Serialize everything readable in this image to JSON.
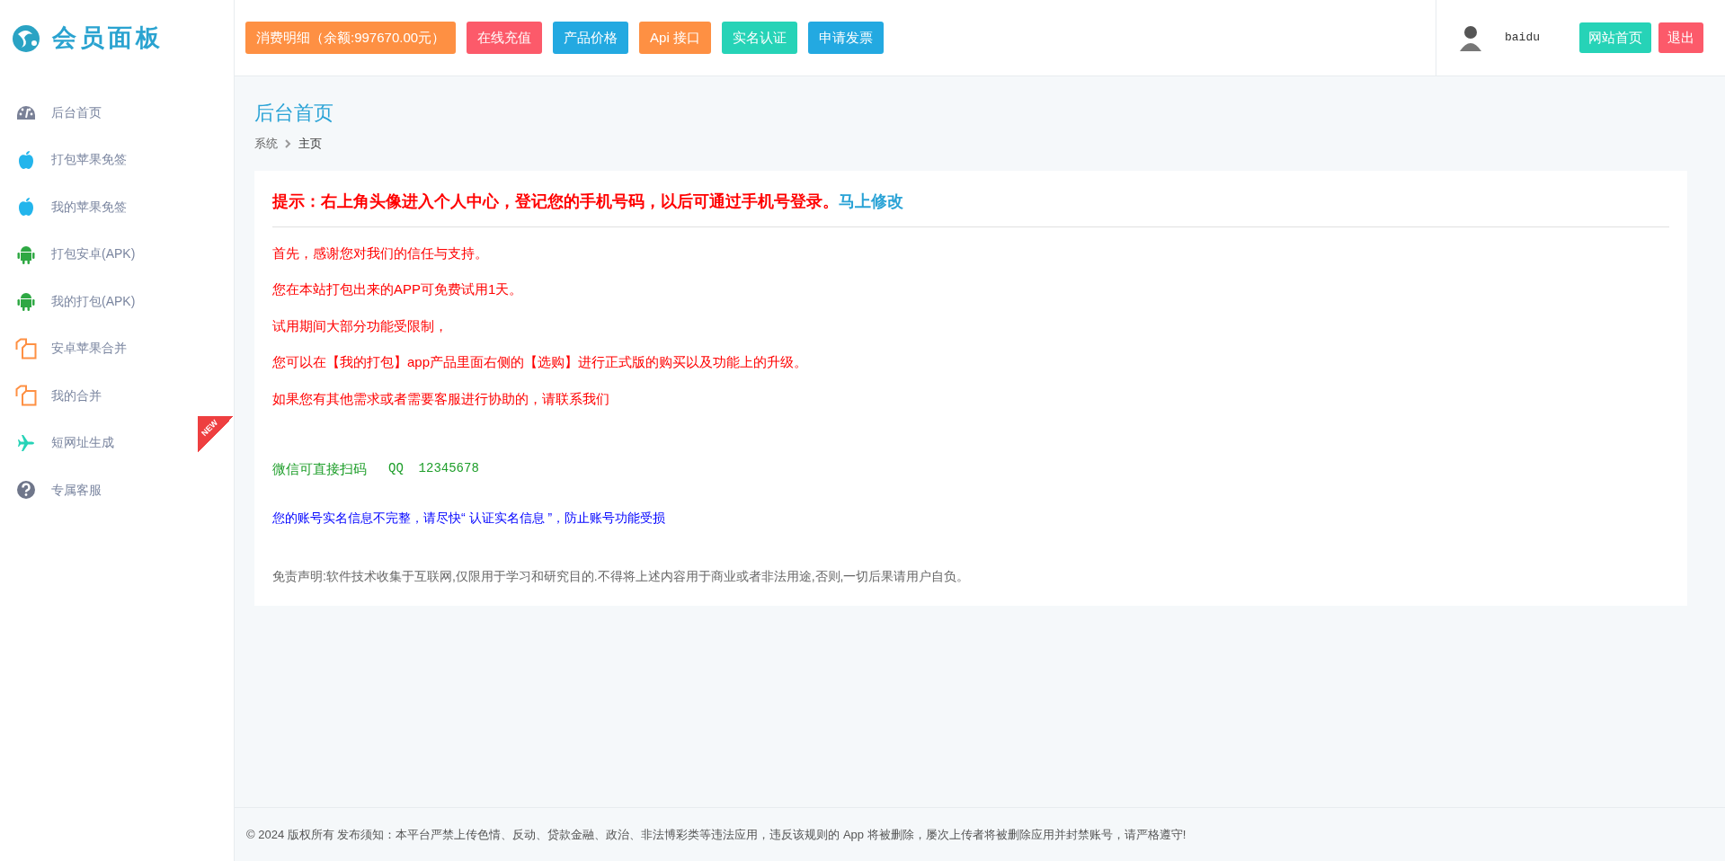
{
  "logo": {
    "text": "会员面板"
  },
  "header_buttons": [
    {
      "label": "消费明细（余额:997670.00元）",
      "color": "#fe9043"
    },
    {
      "label": "在线充值",
      "color": "#fc5a6a"
    },
    {
      "label": "产品价格",
      "color": "#23a9e1"
    },
    {
      "label": "Api 接口",
      "color": "#fe9043"
    },
    {
      "label": "实名认证",
      "color": "#26d3b7"
    },
    {
      "label": "申请发票",
      "color": "#23a9e1"
    }
  ],
  "user": {
    "name": "baidu",
    "buttons": [
      {
        "label": "网站首页",
        "color": "#26d3b7"
      },
      {
        "label": "退出",
        "color": "#fc5a6a"
      }
    ]
  },
  "sidebar": {
    "items": [
      {
        "label": "后台首页",
        "kind": "dashboard"
      },
      {
        "label": "打包苹果免签",
        "kind": "apple"
      },
      {
        "label": "我的苹果免签",
        "kind": "apple"
      },
      {
        "label": "打包安卓(APK)",
        "kind": "android"
      },
      {
        "label": "我的打包(APK)",
        "kind": "android"
      },
      {
        "label": "安卓苹果合并",
        "kind": "copy"
      },
      {
        "label": "我的合并",
        "kind": "copy"
      },
      {
        "label": "短网址生成",
        "kind": "plane",
        "badge": "NEW"
      },
      {
        "label": "专属客服",
        "kind": "help"
      }
    ]
  },
  "page": {
    "title": "后台首页",
    "breadcrumb": [
      "系统",
      "主页"
    ]
  },
  "notice": {
    "tip": "提示：右上角头像进入个人中心，登记您的手机号码，以后可通过手机号登录。",
    "tip_link": "马上修改",
    "lines": [
      "首先，感谢您对我们的信任与支持。",
      "您在本站打包出来的APP可免费试用1天。",
      "试用期间大部分功能受限制，",
      "您可以在【我的打包】app产品里面右侧的【选购】进行正式版的购买以及功能上的升级。",
      "如果您有其他需求或者需要客服进行协助的，请联系我们"
    ],
    "contact": [
      "微信可直接扫码",
      "QQ  12345678"
    ],
    "warning": "您的账号实名信息不完整，请尽快“ 认证实名信息 ”，防止账号功能受损",
    "disclaimer": "免责声明:软件技术收集于互联网,仅限用于学习和研究目的.不得将上述内容用于商业或者非法用途,否则,一切后果请用户自负。"
  },
  "footer": {
    "text": "© 2024 版权所有 发布须知：本平台严禁上传色情、反动、贷款金融、政治、非法博彩类等违法应用，违反该规则的 App 将被删除，屡次上传者将被删除应用并封禁账号，请严格遵守!"
  }
}
